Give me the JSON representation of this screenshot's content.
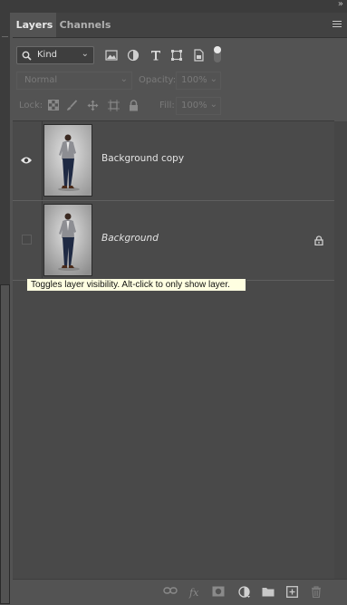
{
  "header": {
    "collapse_glyph": "»"
  },
  "tabs": [
    {
      "label": "Layers",
      "active": true
    },
    {
      "label": "Channels",
      "active": false
    }
  ],
  "filter": {
    "kind_label": "Kind",
    "icons": [
      "image-filter-icon",
      "adjustment-filter-icon",
      "type-filter-icon",
      "shape-filter-icon",
      "smart-object-filter-icon",
      "filter-toggle"
    ]
  },
  "blend": {
    "mode": "Normal",
    "opacity_label": "Opacity:",
    "opacity_value": "100%"
  },
  "lock": {
    "label": "Lock:",
    "fill_label": "Fill:",
    "fill_value": "100%"
  },
  "layers": [
    {
      "name": "Background copy",
      "visible": true,
      "locked": false,
      "italic": false
    },
    {
      "name": "Background",
      "visible": false,
      "locked": true,
      "italic": true
    }
  ],
  "tooltip": "Toggles layer visibility. Alt-click to only show layer.",
  "footer_icons": [
    "link-layers-icon",
    "fx-icon",
    "add-mask-icon",
    "adjustment-layer-icon",
    "new-group-icon",
    "new-layer-icon",
    "delete-layer-icon"
  ],
  "colors": {
    "panel_bg": "#535353",
    "tab_bar": "#424242",
    "tooltip_bg": "#ffffe1"
  }
}
